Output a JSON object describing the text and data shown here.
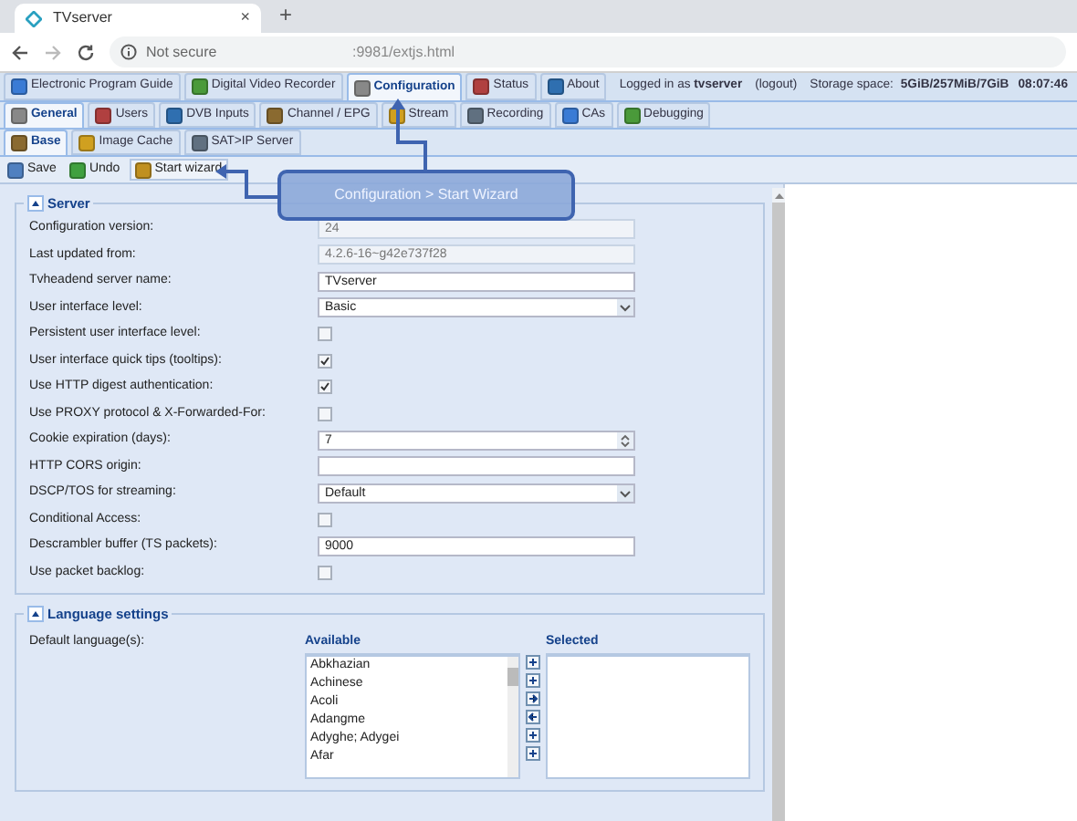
{
  "browser": {
    "tab_title": "TVserver",
    "close": "×",
    "new_tab": "+",
    "security": "Not secure",
    "url": ":9981/extjs.html"
  },
  "main_tabs": [
    {
      "label": "Electronic Program Guide",
      "selected": false
    },
    {
      "label": "Digital Video Recorder",
      "selected": false
    },
    {
      "label": "Configuration",
      "selected": true
    },
    {
      "label": "Status",
      "selected": false
    },
    {
      "label": "About",
      "selected": false
    }
  ],
  "session": {
    "logged_in_label": "Logged in as",
    "user": "tvserver",
    "logout": "(logout)",
    "storage_label": "Storage space:",
    "storage_value": "5GiB/257MiB/7GiB",
    "time": "08:07:46"
  },
  "sub_tabs": [
    {
      "label": "General",
      "selected": true
    },
    {
      "label": "Users",
      "selected": false
    },
    {
      "label": "DVB Inputs",
      "selected": false
    },
    {
      "label": "Channel / EPG",
      "selected": false
    },
    {
      "label": "Stream",
      "selected": false
    },
    {
      "label": "Recording",
      "selected": false
    },
    {
      "label": "CAs",
      "selected": false
    },
    {
      "label": "Debugging",
      "selected": false
    }
  ],
  "section_tabs": [
    {
      "label": "Base",
      "selected": true
    },
    {
      "label": "Image Cache",
      "selected": false
    },
    {
      "label": "SAT>IP Server",
      "selected": false
    }
  ],
  "toolbar": [
    "Save",
    "Undo",
    "Start wizard"
  ],
  "callout": "Configuration > Start Wizard",
  "server": {
    "title": "Server",
    "fields": [
      {
        "label": "Configuration version:",
        "kind": "readonly",
        "value": "24"
      },
      {
        "label": "Last updated from:",
        "kind": "readonly",
        "value": "4.2.6-16~g42e737f28"
      },
      {
        "label": "Tvheadend server name:",
        "kind": "text",
        "value": "TVserver"
      },
      {
        "label": "User interface level:",
        "kind": "select",
        "value": "Basic"
      },
      {
        "label": "Persistent user interface level:",
        "kind": "checkbox",
        "checked": false
      },
      {
        "label": "User interface quick tips (tooltips):",
        "kind": "checkbox",
        "checked": true
      },
      {
        "label": "Use HTTP digest authentication:",
        "kind": "checkbox",
        "checked": true
      },
      {
        "label": "Use PROXY protocol & X-Forwarded-For:",
        "kind": "checkbox",
        "checked": false
      },
      {
        "label": "Cookie expiration (days):",
        "kind": "number",
        "value": "7"
      },
      {
        "label": "HTTP CORS origin:",
        "kind": "text"
      },
      {
        "label": "DSCP/TOS for streaming:",
        "kind": "select",
        "value": "Default"
      },
      {
        "label": "Conditional Access:",
        "kind": "checkbox",
        "checked": false
      },
      {
        "label": "Descrambler buffer (TS packets):",
        "kind": "text",
        "value": "9000"
      },
      {
        "label": "Use packet backlog:",
        "kind": "checkbox",
        "checked": false
      }
    ]
  },
  "language": {
    "title": "Language settings",
    "label": "Default language(s):",
    "available_title": "Available",
    "selected_title": "Selected",
    "available": [
      "Abkhazian",
      "Achinese",
      "Acoli",
      "Adangme",
      "Adyghe; Adygei",
      "Afar"
    ]
  }
}
